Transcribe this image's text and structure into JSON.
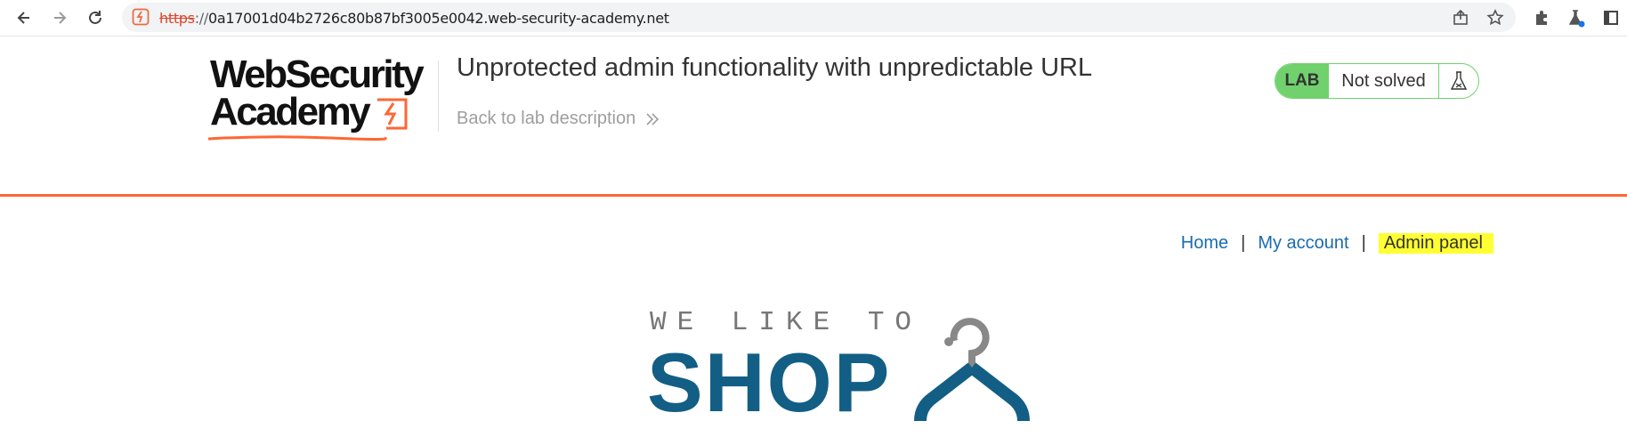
{
  "browser": {
    "url_scheme": "https",
    "url_separator": "://",
    "url_rest": "0a17001d04b2726c80b87bf3005e0042.web-security-academy.net",
    "icons": [
      "back-icon",
      "forward-icon",
      "reload-icon",
      "site-info-icon",
      "share-icon",
      "bookmark-star-icon",
      "extensions-icon",
      "lab-extension-icon",
      "side-panel-icon"
    ]
  },
  "header": {
    "logo_line1": "WebSecurity",
    "logo_line2": "Academy",
    "lab_title": "Unprotected admin functionality with unpredictable URL",
    "back_link": "Back to lab description",
    "lab_badge": "LAB",
    "lab_status": "Not solved"
  },
  "nav": {
    "home": "Home",
    "separator": "|",
    "my_account": "My account",
    "admin_panel": "Admin panel"
  },
  "shop_logo": {
    "tagline": "WE LIKE TO",
    "word": "SHOP"
  },
  "colors": {
    "accent_orange": "#ff6633",
    "lab_green": "#70d16d",
    "link_blue": "#1a6bb0",
    "shop_blue": "#135e84",
    "highlight_yellow": "#ffff33"
  }
}
